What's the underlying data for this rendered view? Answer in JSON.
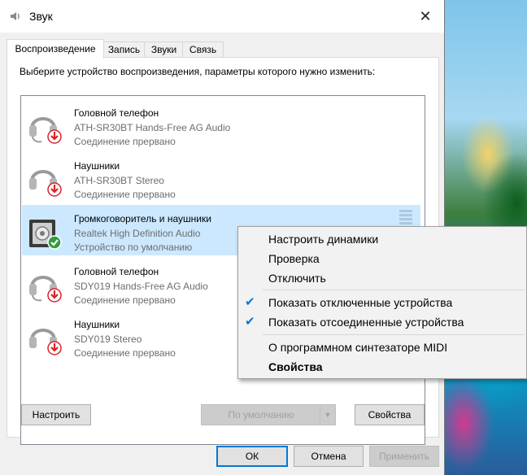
{
  "window": {
    "title": "Звук",
    "close_glyph": "✕",
    "app_icon": "speaker-icon"
  },
  "tabs": [
    {
      "label": "Воспроизведение",
      "active": true
    },
    {
      "label": "Запись",
      "active": false
    },
    {
      "label": "Звуки",
      "active": false
    },
    {
      "label": "Связь",
      "active": false
    }
  ],
  "instructions": "Выберите устройство воспроизведения, параметры которого нужно изменить:",
  "devices": [
    {
      "name": "Головной телефон",
      "sub": "ATH-SR30BT  Hands-Free AG Audio",
      "status": "Соединение прервано",
      "icon": "headset-icon",
      "badge": "disconnected-arrow-icon",
      "selected": false
    },
    {
      "name": "Наушники",
      "sub": "ATH-SR30BT  Stereo",
      "status": "Соединение прервано",
      "icon": "headphones-icon",
      "badge": "disconnected-arrow-icon",
      "selected": false
    },
    {
      "name": "Громкоговоритель и наушники",
      "sub": "Realtek High Definition Audio",
      "status": "Устройство по умолчанию",
      "icon": "speaker-device-icon",
      "badge": "default-check-icon",
      "selected": true
    },
    {
      "name": "Головной телефон",
      "sub": "SDY019 Hands-Free AG Audio",
      "status": "Соединение прервано",
      "icon": "headset-icon",
      "badge": "disconnected-arrow-icon",
      "selected": false
    },
    {
      "name": "Наушники",
      "sub": "SDY019 Stereo",
      "status": "Соединение прервано",
      "icon": "headphones-icon",
      "badge": "disconnected-arrow-icon",
      "selected": false
    }
  ],
  "buttons": {
    "configure": "Настроить",
    "set_default": "По умолчанию",
    "properties": "Свойства",
    "ok": "ОК",
    "cancel": "Отмена",
    "apply": "Применить"
  },
  "context_menu": {
    "items": [
      {
        "label": "Настроить динамики",
        "checked": false,
        "bold": false
      },
      {
        "label": "Проверка",
        "checked": false,
        "bold": false
      },
      {
        "label": "Отключить",
        "checked": false,
        "bold": false
      },
      {
        "label": "Показать отключенные устройства",
        "checked": true,
        "bold": false
      },
      {
        "label": "Показать отсоединенные устройства",
        "checked": true,
        "bold": false
      },
      {
        "label": "О программном синтезаторе MIDI",
        "checked": false,
        "bold": false
      },
      {
        "label": "Свойства",
        "checked": false,
        "bold": true
      }
    ],
    "check_glyph": "✔"
  },
  "colors": {
    "accent": "#0078d7",
    "selection": "#cce8ff",
    "default_badge": "#2e9e3e",
    "disconnected_badge": "#d8232a"
  }
}
